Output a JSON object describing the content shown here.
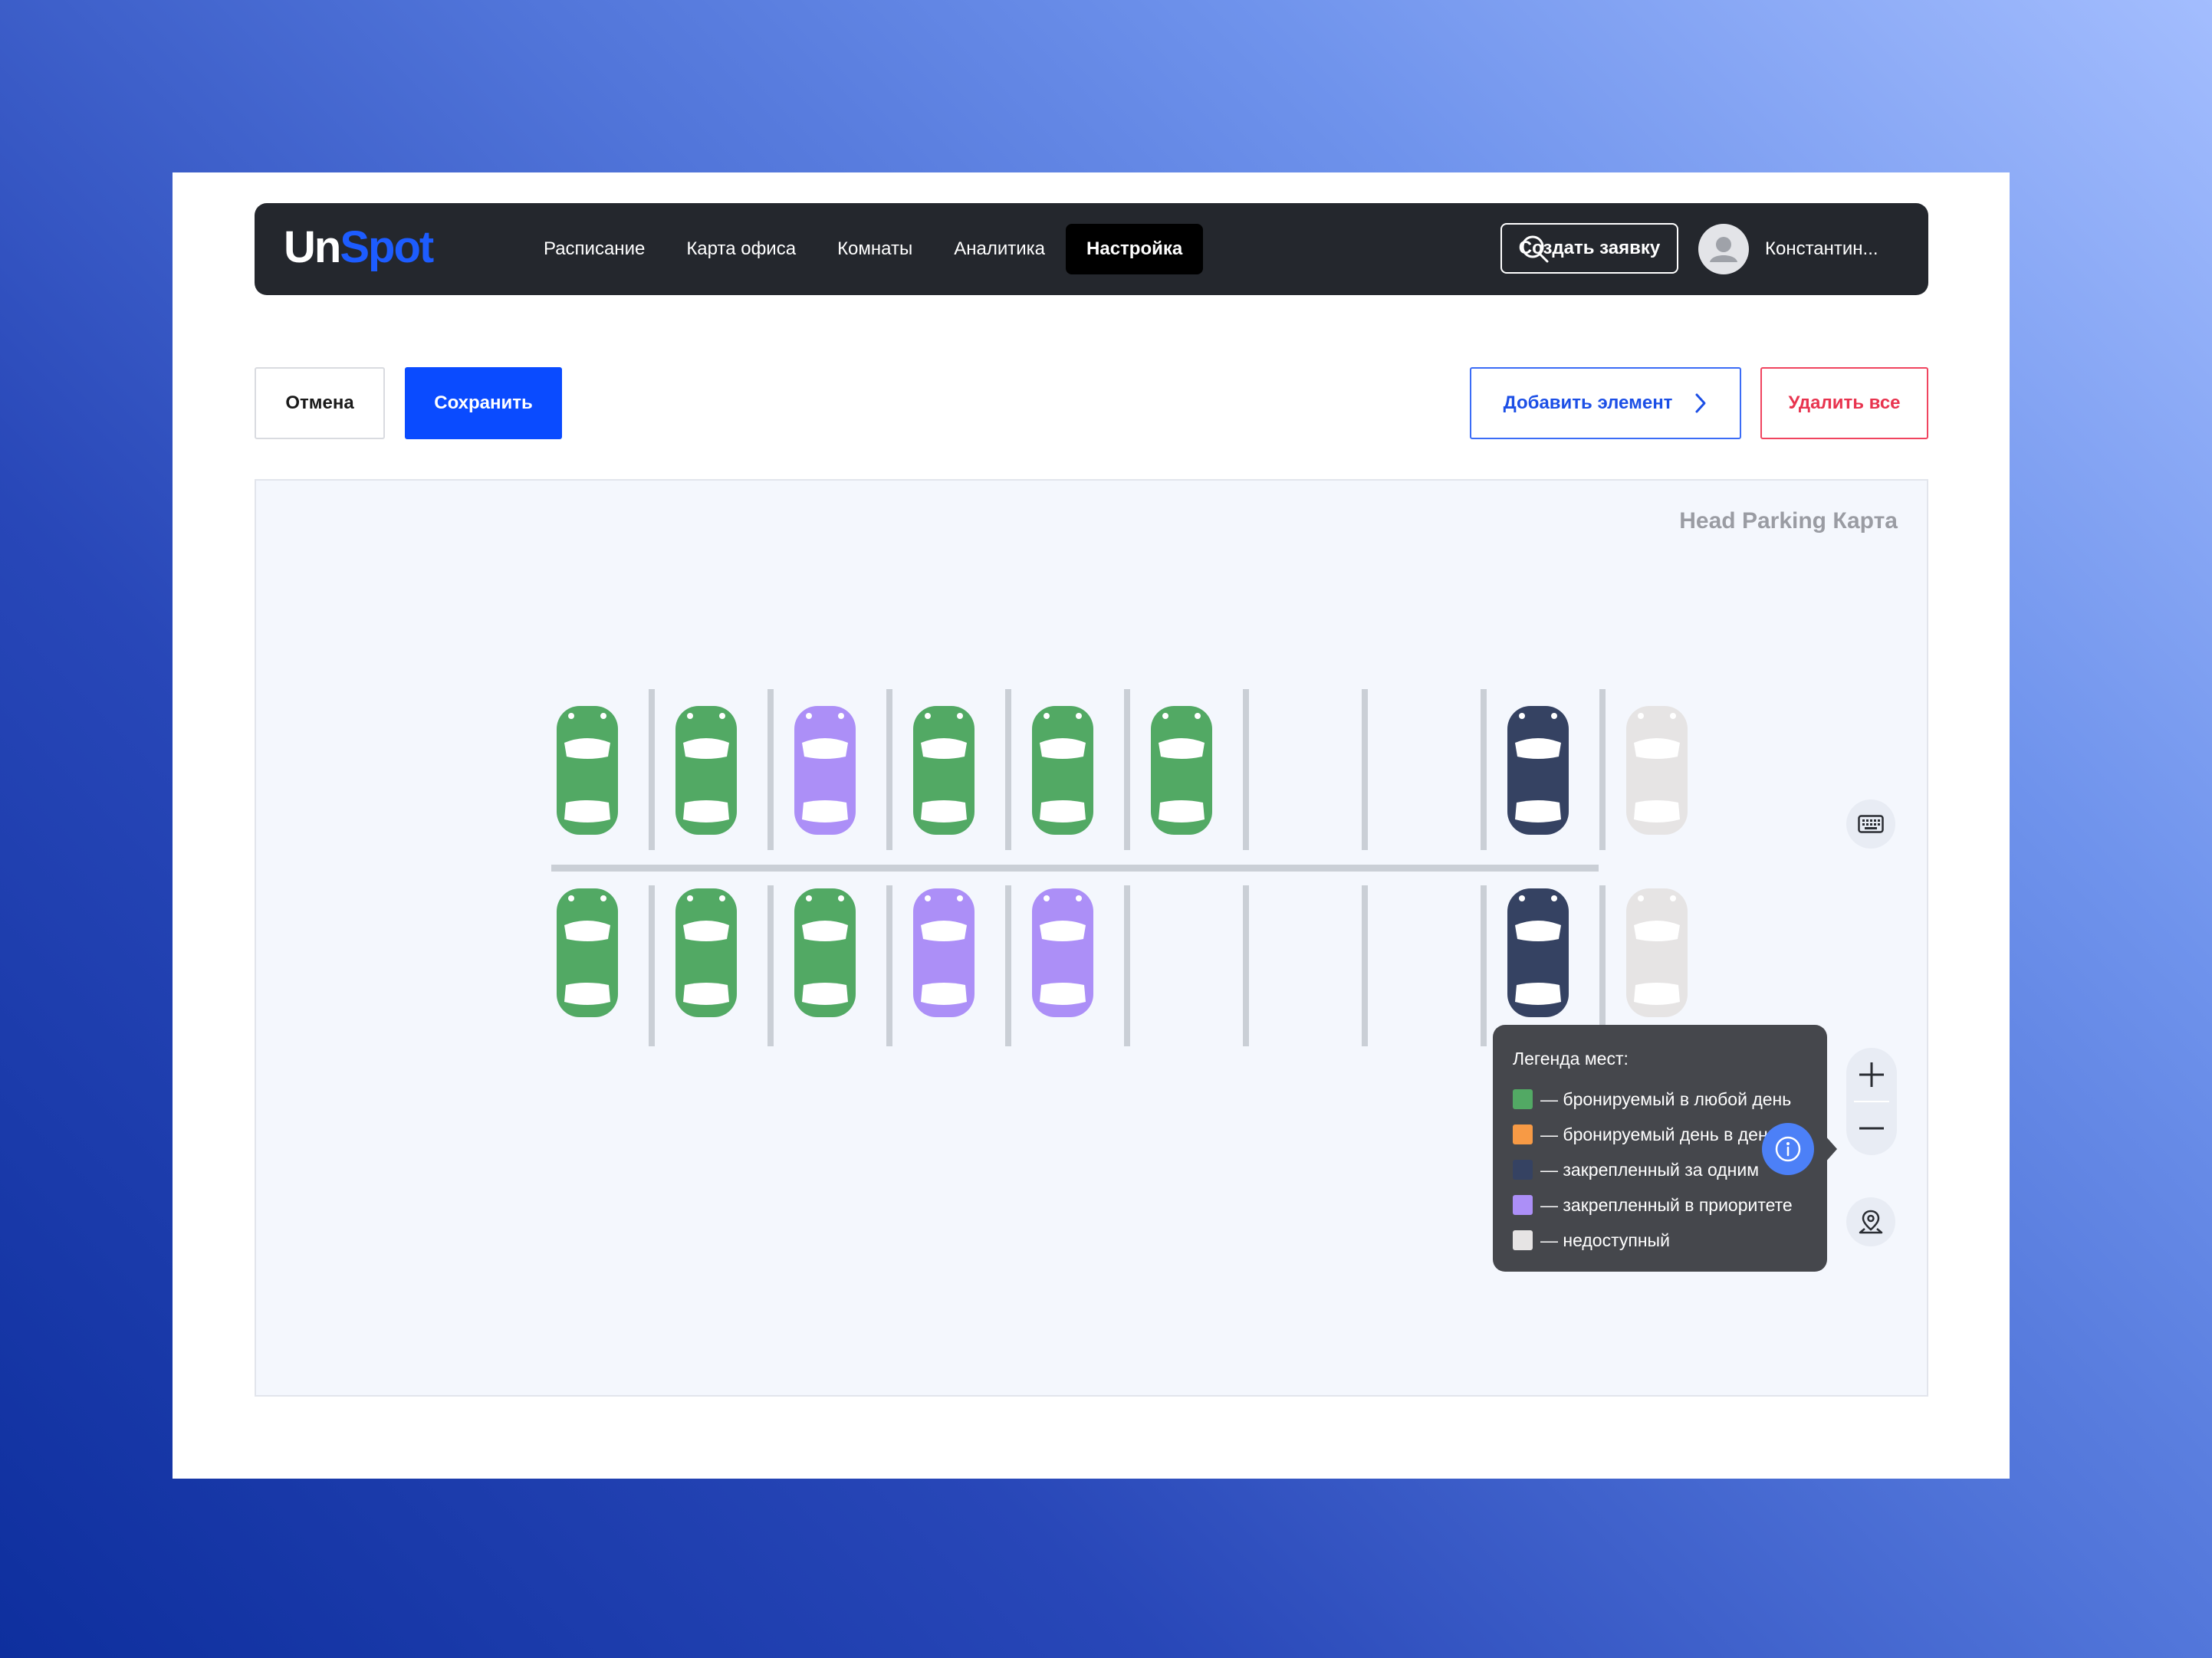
{
  "header": {
    "logo_part1": "Un",
    "logo_part2": "Spot",
    "nav": [
      {
        "label": "Расписание",
        "active": false
      },
      {
        "label": "Карта офиса",
        "active": false
      },
      {
        "label": "Комнаты",
        "active": false
      },
      {
        "label": "Аналитика",
        "active": false
      },
      {
        "label": "Настройка",
        "active": true
      }
    ],
    "create_label": "Создать заявку",
    "user_name": "Константин..."
  },
  "toolbar": {
    "cancel_label": "Отмена",
    "save_label": "Сохранить",
    "add_label": "Добавить элемент",
    "delete_label": "Удалить все"
  },
  "map": {
    "title": "Head Parking Карта",
    "top_row": [
      "available",
      "available",
      "priority",
      "available",
      "available",
      "available",
      "empty",
      "empty",
      "assigned",
      "unavailable"
    ],
    "bottom_row": [
      "available",
      "available",
      "available",
      "priority",
      "priority",
      "empty",
      "empty",
      "empty",
      "assigned",
      "unavailable"
    ]
  },
  "legend": {
    "title": "Легенда мест:",
    "items": [
      {
        "key": "available",
        "color": "#52a964",
        "label": "— бронируемый в любой день"
      },
      {
        "key": "same_day",
        "color": "#f79a45",
        "label": "— бронируемый день в день"
      },
      {
        "key": "assigned",
        "color": "#354262",
        "label": "— закрепленный за одним"
      },
      {
        "key": "priority",
        "color": "#ac8ff7",
        "label": "— закрепленный в приоритете"
      },
      {
        "key": "unavailable",
        "color": "#e6e4e4",
        "label": "— недоступный"
      }
    ]
  },
  "icons": {
    "search": "search-icon",
    "keyboard": "keyboard-icon",
    "zoom_in": "plus-icon",
    "zoom_out": "minus-icon",
    "location": "location-pin-icon",
    "info": "info-icon",
    "chevron": "chevron-right-icon",
    "avatar": "user-avatar-icon"
  }
}
